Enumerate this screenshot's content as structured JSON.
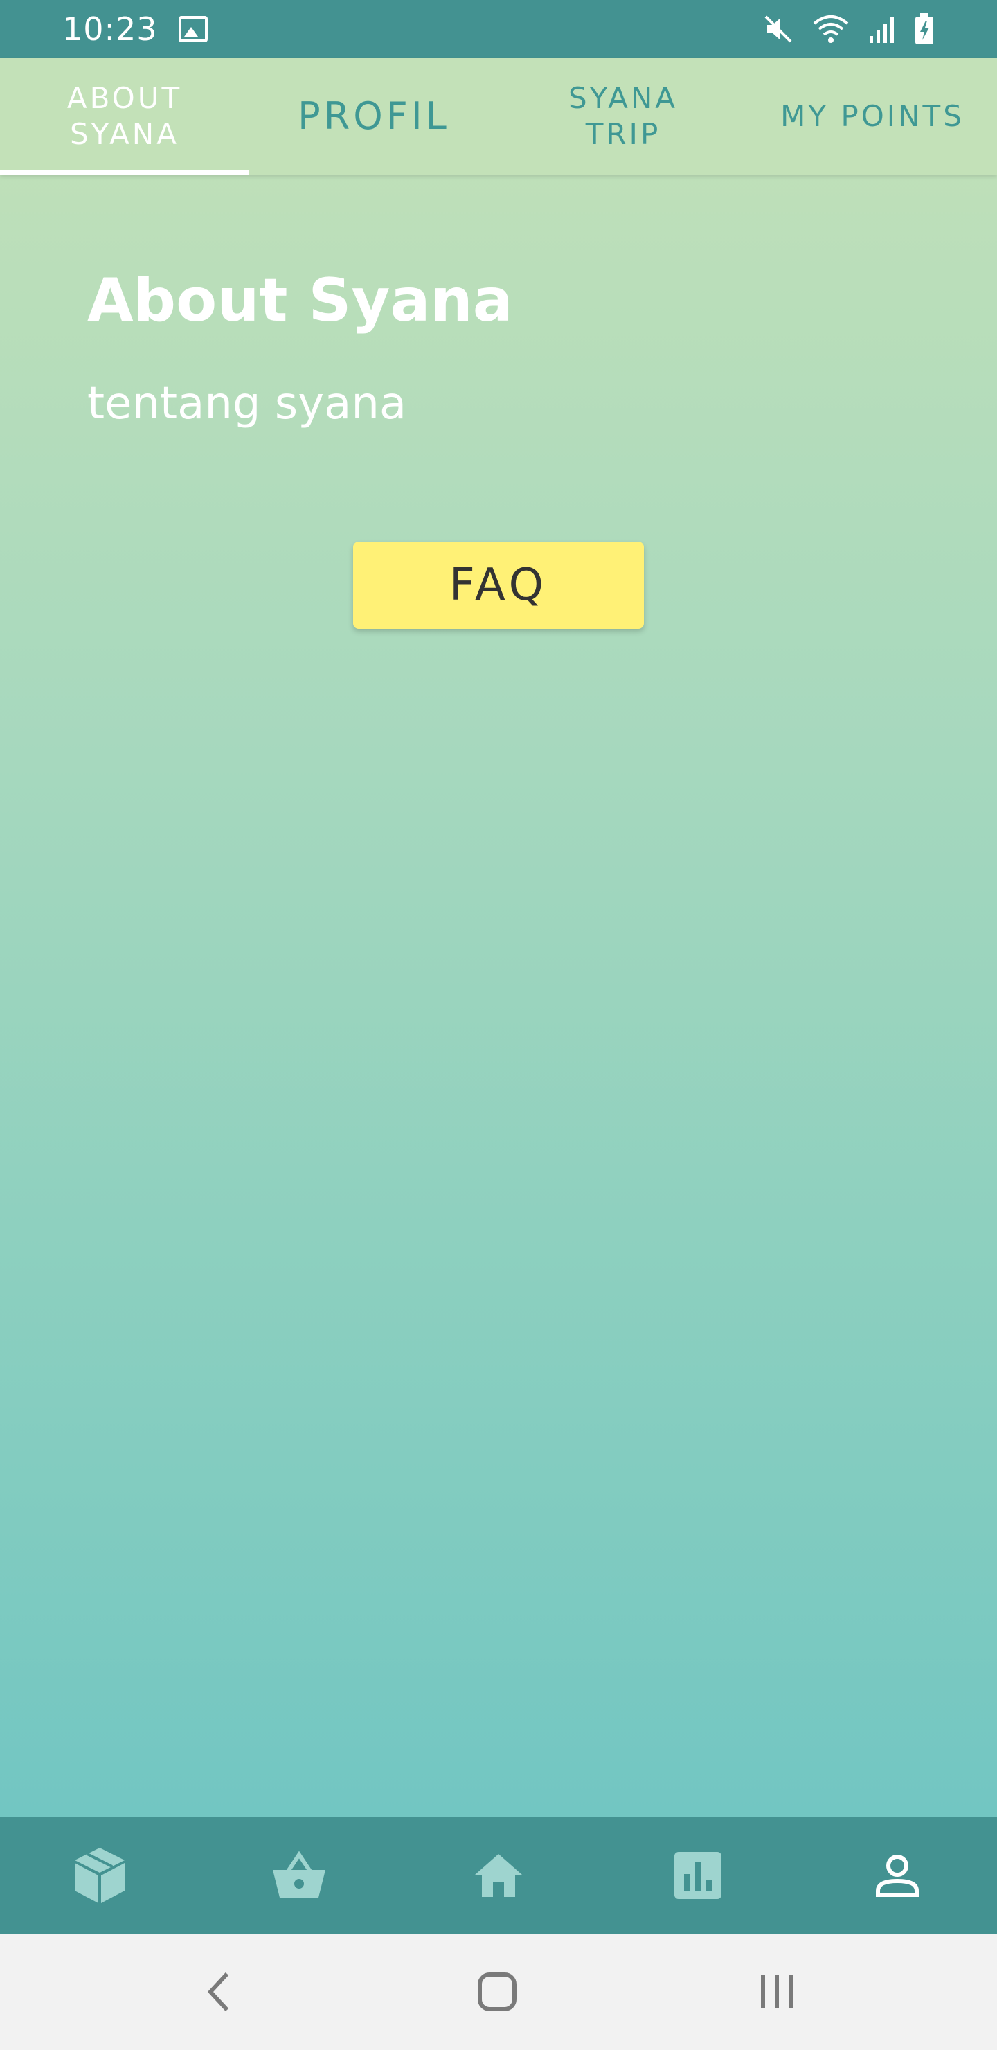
{
  "status_bar": {
    "time": "10:23",
    "icons": [
      "gallery-icon",
      "mute-icon",
      "wifi-icon",
      "signal-icon",
      "battery-charging-icon"
    ]
  },
  "tabs": [
    {
      "label": "ABOUT\nSYANA",
      "active": true
    },
    {
      "label": "PROFIL",
      "active": false
    },
    {
      "label": "SYANA\nTRIP",
      "active": false
    },
    {
      "label": "MY POINTS",
      "active": false
    }
  ],
  "content": {
    "title": "About Syana",
    "subtitle": "tentang syana",
    "faq_label": "FAQ"
  },
  "bottom_nav": {
    "items": [
      "box-icon",
      "basket-icon",
      "home-icon",
      "chart-icon",
      "profile-icon"
    ],
    "active": "profile-icon"
  },
  "system_nav": [
    "back-icon",
    "home-button-icon",
    "recents-icon"
  ],
  "colors": {
    "primary": "#439291",
    "tab_bg": "#c3e1b8",
    "tab_text": "#3f9894",
    "faq_button": "#fff176",
    "gradient_bottom": "#72c6c2"
  }
}
